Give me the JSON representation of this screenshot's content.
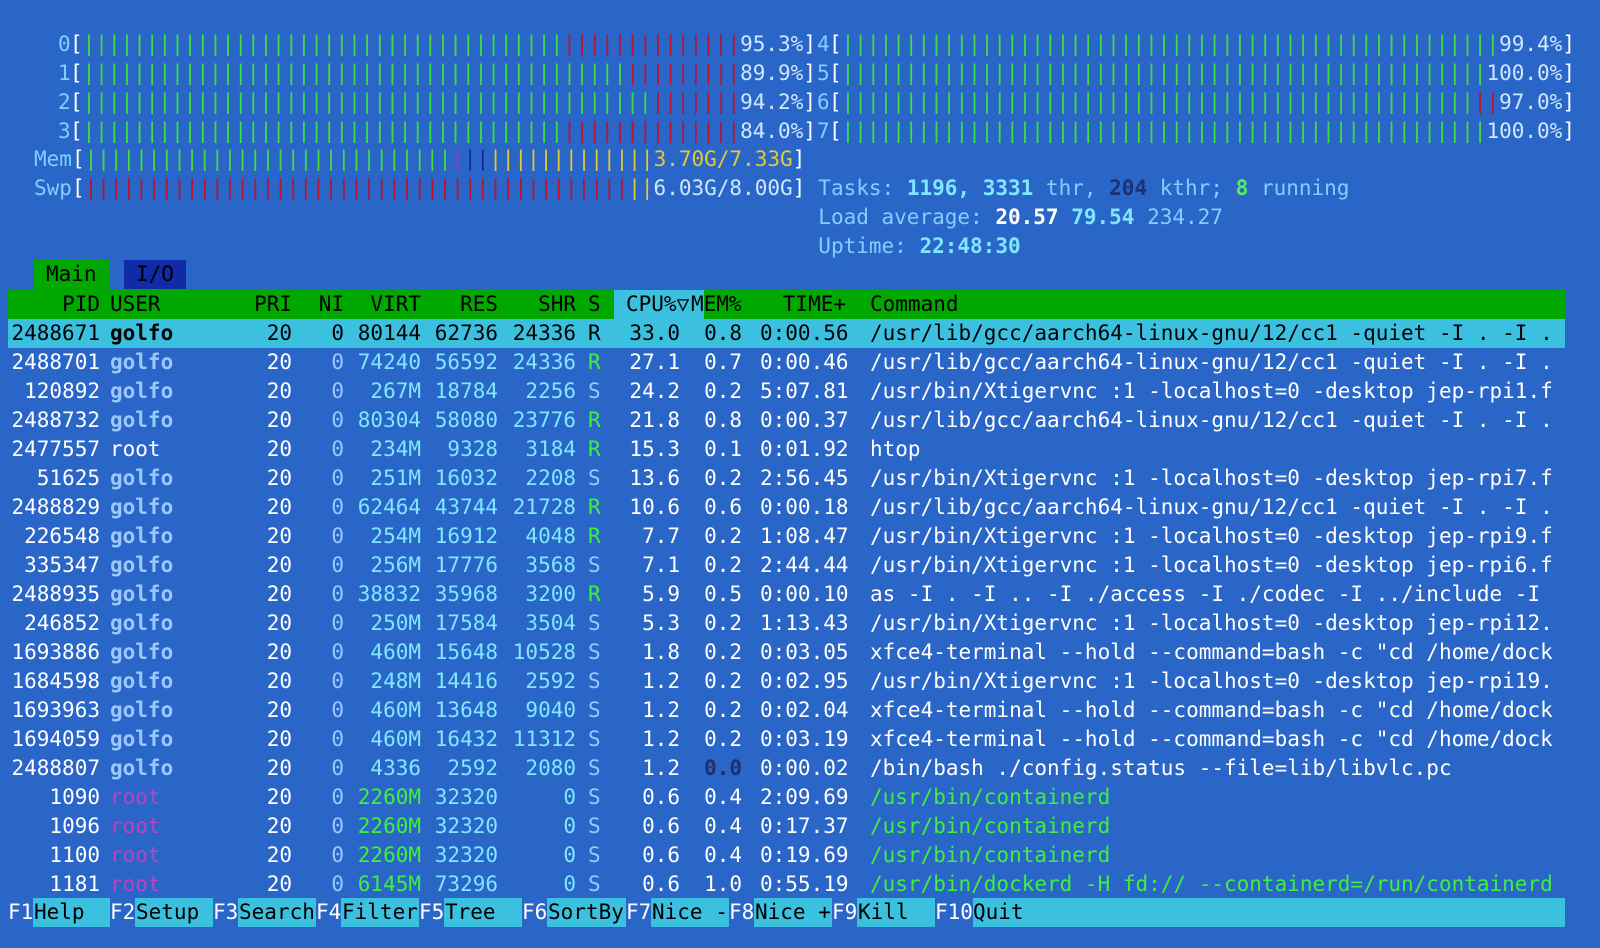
{
  "cpus": [
    {
      "label": "0",
      "value": "95.3%",
      "green": 0.74,
      "red": 0.26
    },
    {
      "label": "1",
      "value": "89.9%",
      "green": 0.82,
      "red": 0.18
    },
    {
      "label": "2",
      "value": "94.2%",
      "green": 0.87,
      "red": 0.13
    },
    {
      "label": "3",
      "value": "84.0%",
      "green": 0.74,
      "red": 0.26
    },
    {
      "label": "4",
      "value": "99.4%",
      "green": 1.0,
      "red": 0.0
    },
    {
      "label": "5",
      "value": "100.0%",
      "green": 1.0,
      "red": 0.0
    },
    {
      "label": "6",
      "value": "97.0%",
      "green": 0.97,
      "red": 0.03
    },
    {
      "label": "7",
      "value": "100.0%",
      "green": 1.0,
      "red": 0.0
    }
  ],
  "mem": {
    "label": "Mem",
    "value": "3.70G/7.33G"
  },
  "swp": {
    "label": "Swp",
    "value": "6.03G/8.00G"
  },
  "tasks": {
    "label": "Tasks:",
    "count": "1196,",
    "thr": "3331",
    "thr_label": "thr,",
    "kthr": "204",
    "kthr_label": "kthr;",
    "running": "8",
    "running_label": "running"
  },
  "load": {
    "label": "Load average:",
    "one": "20.57",
    "five": "79.54",
    "fifteen": "234.27"
  },
  "uptime": {
    "label": "Uptime:",
    "value": "22:48:30"
  },
  "tabs": {
    "main": "Main",
    "io": "I/O"
  },
  "columns": {
    "pid": "PID",
    "user": "USER",
    "pri": "PRI",
    "ni": "NI",
    "virt": "VIRT",
    "res": "RES",
    "shr": "SHR",
    "s": "S",
    "cpu": "CPU%▽",
    "mem": "MEM%",
    "time": "TIME+",
    "command": "Command"
  },
  "processes": [
    {
      "pid": "2488671",
      "user": "golfo",
      "pri": "20",
      "ni": "0",
      "virt": "80144",
      "res": "62736",
      "shr": "24336",
      "s": "R",
      "cpu": "33.0",
      "mem": "0.8",
      "time": "0:00.56",
      "cmd": "/usr/lib/gcc/aarch64-linux-gnu/12/cc1 -quiet -I . -I ."
    },
    {
      "pid": "2488701",
      "user": "golfo",
      "pri": "20",
      "ni": "0",
      "virt": "74240",
      "res": "56592",
      "shr": "24336",
      "s": "R",
      "cpu": "27.1",
      "mem": "0.7",
      "time": "0:00.46",
      "cmd": "/usr/lib/gcc/aarch64-linux-gnu/12/cc1 -quiet -I . -I ."
    },
    {
      "pid": "120892",
      "user": "golfo",
      "pri": "20",
      "ni": "0",
      "virt": "267M",
      "res": "18784",
      "shr": "2256",
      "s": "S",
      "cpu": "24.2",
      "mem": "0.2",
      "time": "5:07.81",
      "cmd": "/usr/bin/Xtigervnc :1 -localhost=0 -desktop jep-rpi1.f"
    },
    {
      "pid": "2488732",
      "user": "golfo",
      "pri": "20",
      "ni": "0",
      "virt": "80304",
      "res": "58080",
      "shr": "23776",
      "s": "R",
      "cpu": "21.8",
      "mem": "0.8",
      "time": "0:00.37",
      "cmd": "/usr/lib/gcc/aarch64-linux-gnu/12/cc1 -quiet -I . -I ."
    },
    {
      "pid": "2477557",
      "user": "root",
      "pri": "20",
      "ni": "0",
      "virt": "234M",
      "res": "9328",
      "shr": "3184",
      "s": "R",
      "cpu": "15.3",
      "mem": "0.1",
      "time": "0:01.92",
      "cmd": "htop"
    },
    {
      "pid": "51625",
      "user": "golfo",
      "pri": "20",
      "ni": "0",
      "virt": "251M",
      "res": "16032",
      "shr": "2208",
      "s": "S",
      "cpu": "13.6",
      "mem": "0.2",
      "time": "2:56.45",
      "cmd": "/usr/bin/Xtigervnc :1 -localhost=0 -desktop jep-rpi7.f"
    },
    {
      "pid": "2488829",
      "user": "golfo",
      "pri": "20",
      "ni": "0",
      "virt": "62464",
      "res": "43744",
      "shr": "21728",
      "s": "R",
      "cpu": "10.6",
      "mem": "0.6",
      "time": "0:00.18",
      "cmd": "/usr/lib/gcc/aarch64-linux-gnu/12/cc1 -quiet -I . -I ."
    },
    {
      "pid": "226548",
      "user": "golfo",
      "pri": "20",
      "ni": "0",
      "virt": "254M",
      "res": "16912",
      "shr": "4048",
      "s": "R",
      "cpu": "7.7",
      "mem": "0.2",
      "time": "1:08.47",
      "cmd": "/usr/bin/Xtigervnc :1 -localhost=0 -desktop jep-rpi9.f"
    },
    {
      "pid": "335347",
      "user": "golfo",
      "pri": "20",
      "ni": "0",
      "virt": "256M",
      "res": "17776",
      "shr": "3568",
      "s": "S",
      "cpu": "7.1",
      "mem": "0.2",
      "time": "2:44.44",
      "cmd": "/usr/bin/Xtigervnc :1 -localhost=0 -desktop jep-rpi6.f"
    },
    {
      "pid": "2488935",
      "user": "golfo",
      "pri": "20",
      "ni": "0",
      "virt": "38832",
      "res": "35968",
      "shr": "3200",
      "s": "R",
      "cpu": "5.9",
      "mem": "0.5",
      "time": "0:00.10",
      "cmd": "as -I . -I .. -I ./access -I ./codec -I ../include -I"
    },
    {
      "pid": "246852",
      "user": "golfo",
      "pri": "20",
      "ni": "0",
      "virt": "250M",
      "res": "17584",
      "shr": "3504",
      "s": "S",
      "cpu": "5.3",
      "mem": "0.2",
      "time": "1:13.43",
      "cmd": "/usr/bin/Xtigervnc :1 -localhost=0 -desktop jep-rpi12."
    },
    {
      "pid": "1693886",
      "user": "golfo",
      "pri": "20",
      "ni": "0",
      "virt": "460M",
      "res": "15648",
      "shr": "10528",
      "s": "S",
      "cpu": "1.8",
      "mem": "0.2",
      "time": "0:03.05",
      "cmd": "xfce4-terminal --hold --command=bash -c \"cd /home/dock"
    },
    {
      "pid": "1684598",
      "user": "golfo",
      "pri": "20",
      "ni": "0",
      "virt": "248M",
      "res": "14416",
      "shr": "2592",
      "s": "S",
      "cpu": "1.2",
      "mem": "0.2",
      "time": "0:02.95",
      "cmd": "/usr/bin/Xtigervnc :1 -localhost=0 -desktop jep-rpi19."
    },
    {
      "pid": "1693963",
      "user": "golfo",
      "pri": "20",
      "ni": "0",
      "virt": "460M",
      "res": "13648",
      "shr": "9040",
      "s": "S",
      "cpu": "1.2",
      "mem": "0.2",
      "time": "0:02.04",
      "cmd": "xfce4-terminal --hold --command=bash -c \"cd /home/dock"
    },
    {
      "pid": "1694059",
      "user": "golfo",
      "pri": "20",
      "ni": "0",
      "virt": "460M",
      "res": "16432",
      "shr": "11312",
      "s": "S",
      "cpu": "1.2",
      "mem": "0.2",
      "time": "0:03.19",
      "cmd": "xfce4-terminal --hold --command=bash -c \"cd /home/dock"
    },
    {
      "pid": "2488807",
      "user": "golfo",
      "pri": "20",
      "ni": "0",
      "virt": "4336",
      "res": "2592",
      "shr": "2080",
      "s": "S",
      "cpu": "1.2",
      "mem": "0.0",
      "time": "0:00.02",
      "cmd": "/bin/bash ./config.status --file=lib/libvlc.pc"
    },
    {
      "pid": "1090",
      "user": "root",
      "pri": "20",
      "ni": "0",
      "virt": "2260M",
      "res": "32320",
      "shr": "0",
      "s": "S",
      "cpu": "0.6",
      "mem": "0.4",
      "time": "2:09.69",
      "cmd": "/usr/bin/containerd"
    },
    {
      "pid": "1096",
      "user": "root",
      "pri": "20",
      "ni": "0",
      "virt": "2260M",
      "res": "32320",
      "shr": "0",
      "s": "S",
      "cpu": "0.6",
      "mem": "0.4",
      "time": "0:17.37",
      "cmd": "/usr/bin/containerd"
    },
    {
      "pid": "1100",
      "user": "root",
      "pri": "20",
      "ni": "0",
      "virt": "2260M",
      "res": "32320",
      "shr": "0",
      "s": "S",
      "cpu": "0.6",
      "mem": "0.4",
      "time": "0:19.69",
      "cmd": "/usr/bin/containerd"
    },
    {
      "pid": "1181",
      "user": "root",
      "pri": "20",
      "ni": "0",
      "virt": "6145M",
      "res": "73296",
      "shr": "0",
      "s": "S",
      "cpu": "0.6",
      "mem": "1.0",
      "time": "0:55.19",
      "cmd": "/usr/bin/dockerd -H fd:// --containerd=/run/containerd"
    }
  ],
  "footer": [
    {
      "key": "F1",
      "label": "Help"
    },
    {
      "key": "F2",
      "label": "Setup"
    },
    {
      "key": "F3",
      "label": "Search"
    },
    {
      "key": "F4",
      "label": "Filter"
    },
    {
      "key": "F5",
      "label": "Tree"
    },
    {
      "key": "F6",
      "label": "SortBy"
    },
    {
      "key": "F7",
      "label": "Nice -"
    },
    {
      "key": "F8",
      "label": "Nice +"
    },
    {
      "key": "F9",
      "label": "Kill"
    },
    {
      "key": "F10",
      "label": "Quit"
    }
  ]
}
